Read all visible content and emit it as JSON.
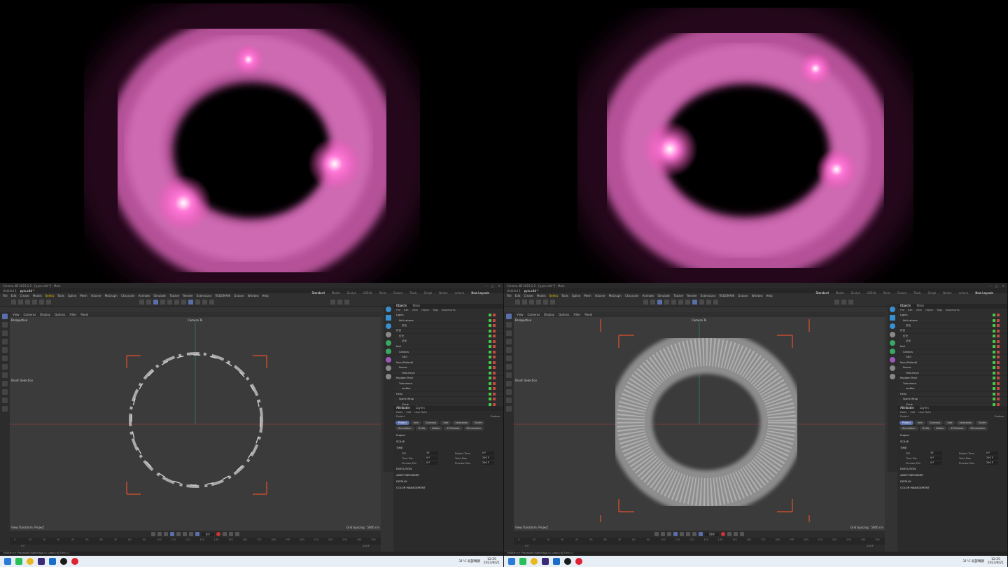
{
  "renders": [
    {
      "name": "render-left"
    },
    {
      "name": "render-right"
    }
  ],
  "app": {
    "title": "Cinema 4D 2023.2.2 - [pyro.c4d *] - Main",
    "file_tab": "pyro.c4d *",
    "file_tab2": "Untitled 1",
    "layouts": [
      "Standard",
      "Model",
      "Sculpt",
      "UVEdit",
      "Paint",
      "Groom",
      "Track",
      "Script",
      "Nodes",
      "octane"
    ],
    "new_layouts": "New Layouts",
    "menu": [
      "File",
      "Edit",
      "Create",
      "Modes",
      "Select",
      "Tools",
      "Spline",
      "Mesh",
      "Volume",
      "MoGraph",
      "Character",
      "Animate",
      "Simulate",
      "Tracker",
      "Render",
      "Extensions",
      "RSDOMAIN",
      "Octane",
      "Window",
      "Help"
    ],
    "vp_menu": [
      "View",
      "Cameras",
      "Display",
      "Options",
      "Filter",
      "Panel"
    ],
    "vp_name": "Perspective",
    "camera_label": "Camera.Ta",
    "brush_selection": "Brush Selection",
    "view_transform": "View Transform: Project",
    "grid_spacing": "Grid Spacing : 5000 cm",
    "panel_tabs": [
      "Objects",
      "Takes"
    ],
    "panel_menu": [
      "File",
      "Edit",
      "View",
      "Object",
      "Tags",
      "Bookmarks"
    ],
    "objects": [
      "Lights",
      "fold.volume",
      "灯光",
      "灯光",
      "灯光",
      "灯光",
      "Null",
      "Camera",
      "GEO",
      "Pyro (Default)",
      "Forces",
      "Field Force",
      "Random Field",
      "Turbulence",
      "emitter",
      "Helix",
      "Spline Wrap",
      "Circle"
    ],
    "attr_tabs": [
      "Attributes",
      "Layers"
    ],
    "attr_menu": [
      "Mode",
      "Edit",
      "User Data"
    ],
    "attr_project": "Project",
    "attr_custom": "Custom",
    "attr_buttons": [
      "Project",
      "Info",
      "Cinema4",
      "Xref",
      "Animation",
      "Bullet",
      "Simulation",
      "To Do",
      "Nodes",
      "X-Particles",
      "Dimensions"
    ],
    "sections": [
      "SCALE",
      "TIME",
      "EXECUTION",
      "ASSET BROWSER",
      "DISPLAY",
      "COLOR MANAGEMENT"
    ],
    "section_project": "Project",
    "fields_left": [
      {
        "label": "FPS",
        "value": "30"
      },
      {
        "label": "Time Min",
        "value": "0 F"
      },
      {
        "label": "Preview Min",
        "value": "0 F"
      }
    ],
    "fields_right": [
      {
        "label": "Project Time",
        "value": "0 F"
      },
      {
        "label": "Time Max",
        "value": "250 F"
      },
      {
        "label": "Preview Max",
        "value": "250 F"
      }
    ],
    "ruler": [
      "0",
      "10",
      "20",
      "30",
      "40",
      "50",
      "60",
      "70",
      "80",
      "90",
      "100",
      "110",
      "120",
      "130",
      "140",
      "150",
      "160",
      "170",
      "180",
      "190",
      "200",
      "210",
      "220",
      "230",
      "240",
      "250"
    ],
    "frame_left": "0 F",
    "frame_right": "79 F",
    "end_frame": "250 F",
    "status": "Octane:<< Processed label(flags=0, class=0) Error=1",
    "weather": "31°C 局部晴朗",
    "time": "12:25",
    "date": "2023/8/21"
  }
}
